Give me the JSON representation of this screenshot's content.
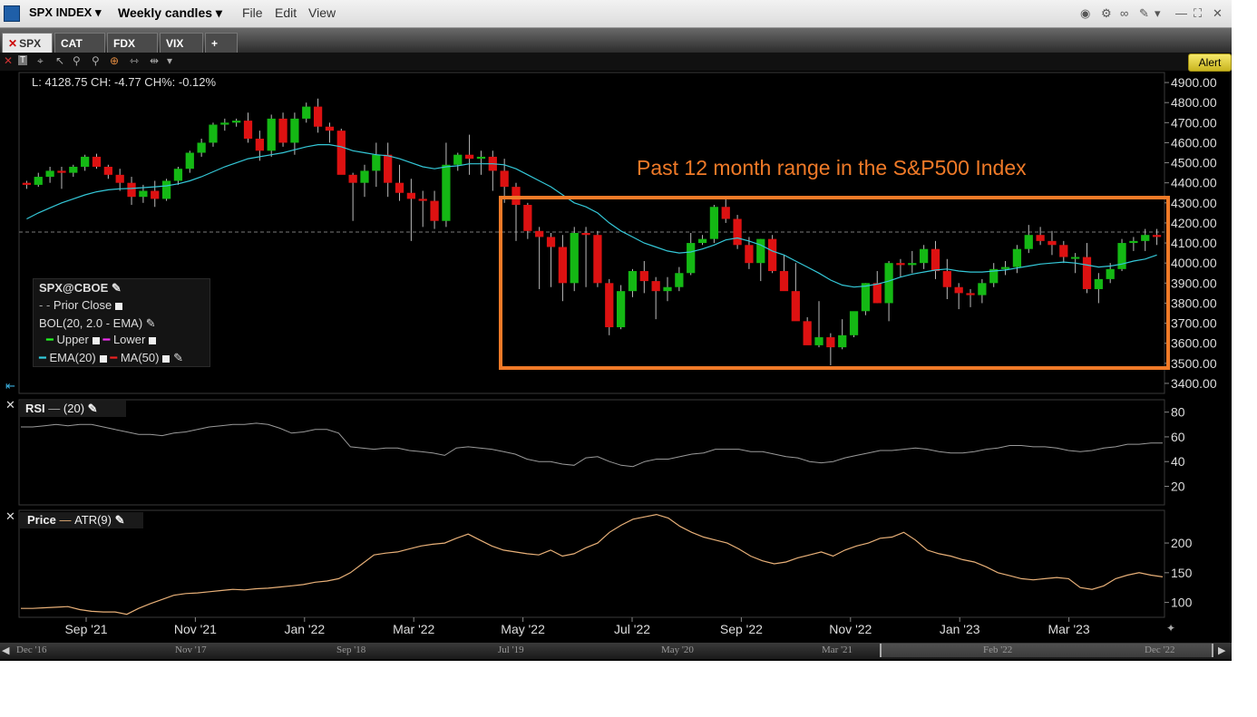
{
  "titlebar": {
    "symbol": "SPX INDEX",
    "interval": "Weekly candles",
    "menus": [
      "File",
      "Edit",
      "View"
    ]
  },
  "tabs": [
    "SPX",
    "CAT",
    "FDX",
    "VIX",
    "+"
  ],
  "toolbar": {
    "alert_label": "Alert"
  },
  "info_line": "L: 4128.75 CH: -4.77 CH%: -0.12%",
  "annotation": "Past 12 month range in the S&P500 Index",
  "legend": {
    "title": "SPX@CBOE",
    "prior_close": "Prior Close",
    "bol": "BOL(20, 2.0 - EMA)",
    "upper": "Upper",
    "lower": "Lower",
    "ema": "EMA(20)",
    "ma": "MA(50)"
  },
  "rsi_panel": {
    "title": "RSI",
    "param": "(20)"
  },
  "atr_panel": {
    "title": "Price",
    "param": "ATR(9)"
  },
  "colors": {
    "up": "#14b814",
    "down": "#dd1111",
    "ema": "#34c8d8",
    "range_box": "#f07a28",
    "atr": "#e8b078",
    "rsi": "#9a9a9a"
  },
  "bottom_nav": [
    "Dec '16",
    "Nov '17",
    "Sep '18",
    "Jul '19",
    "May '20",
    "Mar '21",
    "Feb '22",
    "Dec '22"
  ],
  "chart_data": [
    {
      "type": "candlestick",
      "ylim": [
        3350,
        4950
      ],
      "y_ticks": [
        "4900.00",
        "4800.00",
        "4700.00",
        "4600.00",
        "4500.00",
        "4400.00",
        "4300.00",
        "4200.00",
        "4100.00",
        "4000.00",
        "3900.00",
        "3800.00",
        "3700.00",
        "3600.00",
        "3500.00",
        "3400.00"
      ],
      "x_labels": [
        "Sep '21",
        "Nov '21",
        "Jan '22",
        "Mar '22",
        "May '22",
        "Jul '22",
        "Sep '22",
        "Nov '22",
        "Jan '23",
        "Mar '23"
      ],
      "candles": [
        [
          4400,
          4410,
          4370,
          4390
        ],
        [
          4390,
          4450,
          4380,
          4430
        ],
        [
          4430,
          4480,
          4400,
          4460
        ],
        [
          4460,
          4480,
          4370,
          4450
        ],
        [
          4450,
          4490,
          4430,
          4480
        ],
        [
          4480,
          4540,
          4460,
          4530
        ],
        [
          4530,
          4545,
          4470,
          4480
        ],
        [
          4480,
          4490,
          4420,
          4440
        ],
        [
          4440,
          4470,
          4360,
          4400
        ],
        [
          4400,
          4430,
          4290,
          4330
        ],
        [
          4330,
          4390,
          4300,
          4360
        ],
        [
          4360,
          4410,
          4280,
          4320
        ],
        [
          4320,
          4420,
          4310,
          4410
        ],
        [
          4410,
          4480,
          4390,
          4470
        ],
        [
          4470,
          4560,
          4450,
          4550
        ],
        [
          4550,
          4620,
          4530,
          4600
        ],
        [
          4600,
          4700,
          4580,
          4690
        ],
        [
          4690,
          4720,
          4660,
          4700
        ],
        [
          4700,
          4720,
          4680,
          4710
        ],
        [
          4710,
          4750,
          4600,
          4620
        ],
        [
          4620,
          4660,
          4510,
          4560
        ],
        [
          4560,
          4740,
          4530,
          4720
        ],
        [
          4720,
          4750,
          4580,
          4600
        ],
        [
          4600,
          4750,
          4540,
          4720
        ],
        [
          4720,
          4800,
          4700,
          4780
        ],
        [
          4780,
          4820,
          4650,
          4680
        ],
        [
          4680,
          4700,
          4600,
          4660
        ],
        [
          4660,
          4670,
          4450,
          4440
        ],
        [
          4440,
          4450,
          4210,
          4400
        ],
        [
          4400,
          4490,
          4330,
          4460
        ],
        [
          4460,
          4600,
          4380,
          4540
        ],
        [
          4540,
          4600,
          4330,
          4400
        ],
        [
          4400,
          4490,
          4310,
          4350
        ],
        [
          4350,
          4420,
          4110,
          4320
        ],
        [
          4320,
          4360,
          4180,
          4310
        ],
        [
          4310,
          4360,
          4170,
          4210
        ],
        [
          4210,
          4600,
          4180,
          4490
        ],
        [
          4490,
          4550,
          4460,
          4540
        ],
        [
          4540,
          4640,
          4440,
          4520
        ],
        [
          4520,
          4560,
          4440,
          4530
        ],
        [
          4530,
          4560,
          4360,
          4460
        ],
        [
          4460,
          4520,
          4300,
          4380
        ],
        [
          4380,
          4400,
          4110,
          4290
        ],
        [
          4290,
          4300,
          4120,
          4160
        ],
        [
          4160,
          4180,
          3870,
          4130
        ],
        [
          4130,
          4150,
          3880,
          4080
        ],
        [
          4080,
          4140,
          3810,
          3900
        ],
        [
          3900,
          4180,
          3860,
          4150
        ],
        [
          4150,
          4180,
          3880,
          4140
        ],
        [
          4140,
          4160,
          3880,
          3900
        ],
        [
          3900,
          3920,
          3640,
          3680
        ],
        [
          3680,
          3890,
          3670,
          3860
        ],
        [
          3860,
          3970,
          3830,
          3960
        ],
        [
          3960,
          4010,
          3850,
          3910
        ],
        [
          3910,
          3930,
          3720,
          3860
        ],
        [
          3860,
          3930,
          3810,
          3880
        ],
        [
          3880,
          3980,
          3860,
          3950
        ],
        [
          3950,
          4150,
          3940,
          4100
        ],
        [
          4100,
          4140,
          4090,
          4120
        ],
        [
          4120,
          4290,
          4100,
          4280
        ],
        [
          4280,
          4320,
          4200,
          4220
        ],
        [
          4220,
          4240,
          4070,
          4090
        ],
        [
          4090,
          4130,
          3970,
          4000
        ],
        [
          4000,
          4120,
          3910,
          4120
        ],
        [
          4120,
          4140,
          3950,
          3960
        ],
        [
          3960,
          4040,
          3870,
          3860
        ],
        [
          3860,
          4000,
          3800,
          3710
        ],
        [
          3710,
          3730,
          3630,
          3590
        ],
        [
          3590,
          3810,
          3580,
          3630
        ],
        [
          3630,
          3650,
          3490,
          3580
        ],
        [
          3580,
          3720,
          3570,
          3640
        ],
        [
          3640,
          3740,
          3630,
          3760
        ],
        [
          3760,
          3900,
          3740,
          3900
        ],
        [
          3900,
          3960,
          3800,
          3800
        ],
        [
          3800,
          4010,
          3710,
          4000
        ],
        [
          4000,
          4020,
          3930,
          3990
        ],
        [
          3990,
          4060,
          3950,
          4000
        ],
        [
          4000,
          4090,
          3970,
          4070
        ],
        [
          4070,
          4110,
          3920,
          3960
        ],
        [
          3960,
          4020,
          3820,
          3880
        ],
        [
          3880,
          3900,
          3770,
          3850
        ],
        [
          3850,
          3870,
          3780,
          3840
        ],
        [
          3840,
          3920,
          3800,
          3900
        ],
        [
          3900,
          4000,
          3880,
          3970
        ],
        [
          3970,
          4010,
          3940,
          3980
        ],
        [
          3980,
          4090,
          3950,
          4070
        ],
        [
          4070,
          4190,
          4050,
          4140
        ],
        [
          4140,
          4180,
          4090,
          4110
        ],
        [
          4110,
          4160,
          4040,
          4090
        ],
        [
          4090,
          4110,
          4000,
          4030
        ],
        [
          4030,
          4050,
          3950,
          4030
        ],
        [
          4030,
          4100,
          3850,
          3870
        ],
        [
          3870,
          3950,
          3800,
          3920
        ],
        [
          3920,
          4000,
          3900,
          3970
        ],
        [
          3970,
          4120,
          3960,
          4100
        ],
        [
          4100,
          4130,
          4060,
          4110
        ],
        [
          4110,
          4170,
          4060,
          4140
        ],
        [
          4140,
          4170,
          4090,
          4130
        ]
      ],
      "ema": [
        4220,
        4250,
        4275,
        4300,
        4320,
        4340,
        4355,
        4365,
        4370,
        4372,
        4376,
        4380,
        4385,
        4395,
        4410,
        4430,
        4455,
        4480,
        4500,
        4520,
        4530,
        4540,
        4550,
        4565,
        4580,
        4590,
        4590,
        4580,
        4560,
        4550,
        4540,
        4535,
        4520,
        4500,
        4480,
        4470,
        4480,
        4485,
        4495,
        4495,
        4495,
        4490,
        4470,
        4440,
        4410,
        4380,
        4340,
        4300,
        4280,
        4250,
        4200,
        4160,
        4130,
        4100,
        4080,
        4060,
        4050,
        4055,
        4070,
        4090,
        4115,
        4125,
        4110,
        4090,
        4060,
        4040,
        4010,
        3980,
        3950,
        3915,
        3890,
        3880,
        3885,
        3895,
        3910,
        3930,
        3945,
        3955,
        3965,
        3970,
        3960,
        3955,
        3955,
        3960,
        3965,
        3975,
        3985,
        3995,
        4000,
        4005,
        4000,
        3990,
        3980,
        3985,
        3995,
        4010,
        4020,
        4040
      ]
    },
    {
      "type": "line",
      "name": "RSI",
      "ylim": [
        5,
        90
      ],
      "y_ticks": [
        80,
        60,
        40,
        20
      ],
      "values": [
        68,
        68,
        69,
        70,
        69,
        70,
        70,
        68,
        66,
        64,
        62,
        62,
        61,
        63,
        64,
        66,
        68,
        69,
        70,
        70,
        71,
        70,
        67,
        63,
        64,
        66,
        66,
        63,
        52,
        51,
        50,
        51,
        51,
        49,
        48,
        47,
        45,
        51,
        52,
        51,
        50,
        48,
        46,
        42,
        40,
        40,
        38,
        37,
        43,
        44,
        40,
        37,
        36,
        40,
        42,
        42,
        44,
        46,
        47,
        50,
        50,
        50,
        48,
        48,
        46,
        44,
        43,
        40,
        39,
        40,
        43,
        45,
        47,
        49,
        49,
        50,
        51,
        50,
        48,
        47,
        47,
        48,
        50,
        51,
        53,
        53,
        52,
        52,
        51,
        49,
        48,
        49,
        51,
        52,
        54,
        54,
        55,
        55
      ]
    },
    {
      "type": "line",
      "name": "ATR(9)",
      "ylim": [
        75,
        255
      ],
      "y_ticks": [
        200,
        150,
        100
      ],
      "values": [
        90,
        90,
        91,
        92,
        93,
        88,
        85,
        84,
        84,
        80,
        90,
        98,
        105,
        112,
        115,
        116,
        118,
        120,
        122,
        121,
        123,
        124,
        126,
        128,
        130,
        134,
        136,
        140,
        150,
        165,
        180,
        183,
        185,
        190,
        195,
        198,
        200,
        208,
        215,
        205,
        195,
        188,
        185,
        182,
        180,
        188,
        178,
        182,
        192,
        200,
        218,
        230,
        240,
        244,
        248,
        242,
        228,
        218,
        210,
        205,
        200,
        190,
        178,
        170,
        165,
        168,
        175,
        180,
        185,
        178,
        188,
        195,
        200,
        208,
        210,
        218,
        205,
        188,
        182,
        178,
        172,
        168,
        160,
        150,
        145,
        140,
        138,
        140,
        142,
        140,
        125,
        122,
        128,
        140,
        146,
        150,
        146,
        143
      ]
    }
  ]
}
